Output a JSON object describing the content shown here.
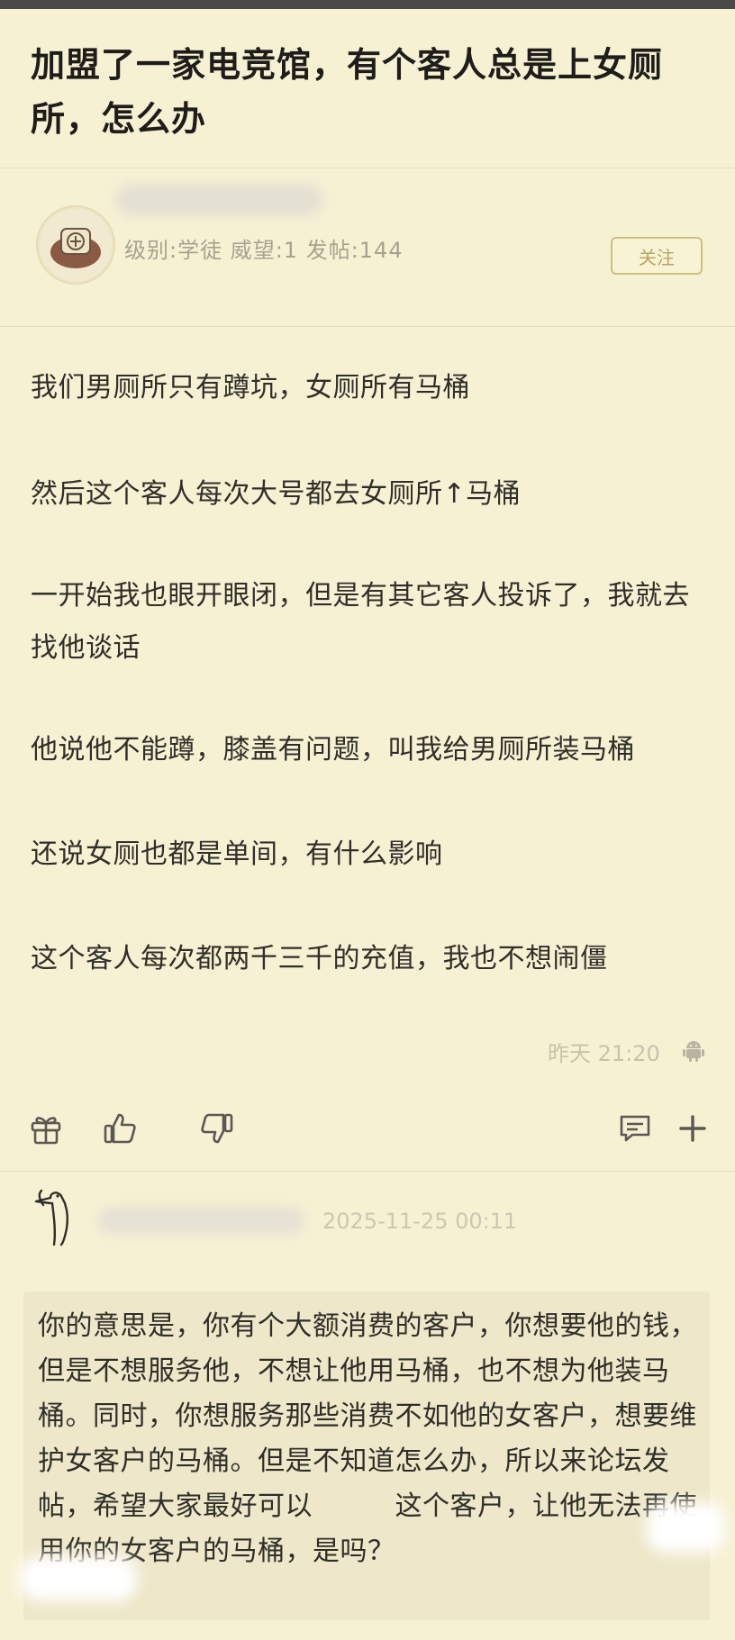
{
  "post": {
    "title": "加盟了一家电竞馆，有个客人总是上女厕所，怎么办",
    "author": {
      "meta": "级别:学徒  威望:1  发帖:144",
      "follow_label": "关注"
    },
    "paragraphs": [
      "我们男厕所只有蹲坑，女厕所有马桶",
      "然后这个客人每次大号都去女厕所↑马桶",
      "一开始我也眼开眼闭，但是有其它客人投诉了，我就去找他谈话",
      "他说他不能蹲，膝盖有问题，叫我给男厕所装马桶",
      "还说女厕也都是单间，有什么影响",
      "这个客人每次都两千三千的充值，我也不想闹僵"
    ],
    "time": "昨天 21:20"
  },
  "actions": {
    "icons": [
      "gift-icon",
      "thumbs-up-icon",
      "thumbs-down-icon",
      "comment-icon",
      "plus-icon"
    ]
  },
  "comment": {
    "time": "2025-11-25 00:11",
    "text": "你的意思是，你有个大额消费的客户，你想要他的钱，但是不想服务他，不想让他用马桶，也不想为他装马桶。同时，你想服务那些消费不如他的女客户，想要维护女客户的马桶。但是不知道怎么办，所以来论坛发帖，希望大家最好可以　　　这个客户，让他无法再使用你的女客户的马桶，是吗？"
  }
}
